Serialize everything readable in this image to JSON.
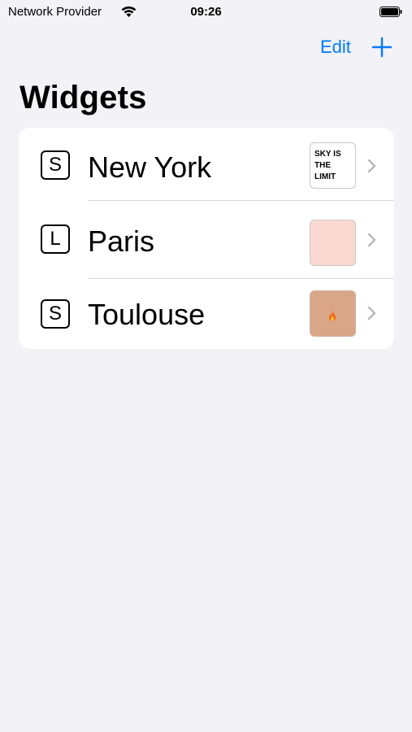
{
  "status_bar": {
    "carrier": "Network Provider",
    "time": "09:26"
  },
  "nav": {
    "edit_label": "Edit",
    "add_icon": "plus-icon"
  },
  "title": "Widgets",
  "widgets": [
    {
      "size": "S",
      "name": "New York",
      "thumbnail_text": "SKY IS THE LIMIT"
    },
    {
      "size": "L",
      "name": "Paris",
      "thumbnail_text": ""
    },
    {
      "size": "S",
      "name": "Toulouse",
      "thumbnail_text": ""
    }
  ],
  "colors": {
    "accent": "#007aff",
    "background": "#f2f2f7",
    "card": "#ffffff"
  }
}
